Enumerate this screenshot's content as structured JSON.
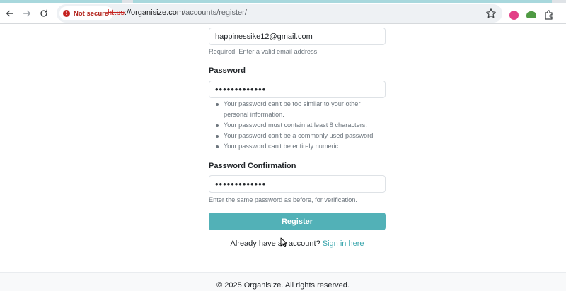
{
  "browser": {
    "security_label": "Not secure",
    "url_scheme": "https",
    "url_host": "://organisize.com",
    "url_path": "/accounts/register/"
  },
  "form": {
    "email_value": "happinessike12@gmail.com",
    "email_help": "Required. Enter a valid email address.",
    "password_label": "Password",
    "password_value": "•••••••••••••",
    "password_rules": [
      "Your password can't be too similar to your other",
      "personal information.",
      "Your password must contain at least 8 characters.",
      "Your password can't be a commonly used password.",
      "Your password can't be entirely numeric."
    ],
    "confirm_label": "Password Confirmation",
    "confirm_value": "•••••••••••••",
    "confirm_help": "Enter the same password as before, for verification.",
    "register_label": "Register",
    "signin_prompt": "Already have an account?",
    "signin_link": "Sign in here"
  },
  "footer": {
    "copyright": "© 2025 Organisize. All rights reserved."
  },
  "colors": {
    "accent": "#52b1b7",
    "link": "#3aa6ad",
    "warning": "#c5221f"
  }
}
